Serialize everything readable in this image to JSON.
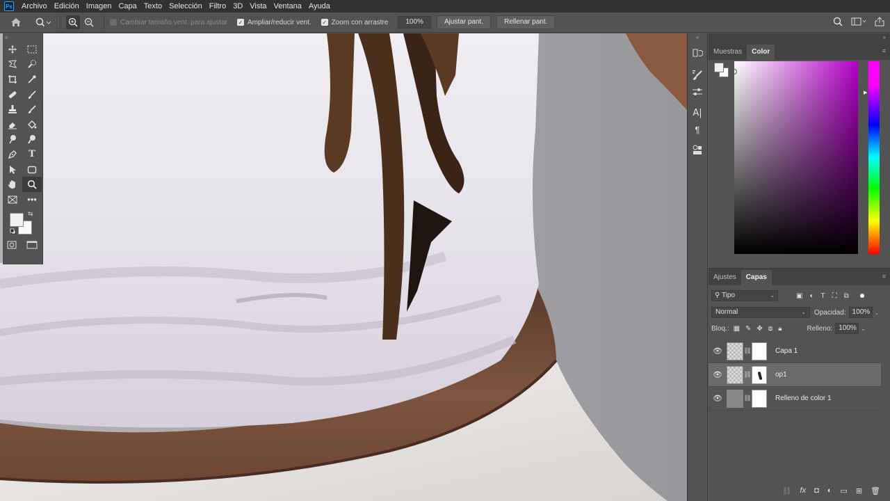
{
  "app": {
    "logo_text": "Ps"
  },
  "menu": [
    "Archivo",
    "Edición",
    "Imagen",
    "Capa",
    "Texto",
    "Selección",
    "Filtro",
    "3D",
    "Vista",
    "Ventana",
    "Ayuda"
  ],
  "options": {
    "resize_windows_label": "Cambiar tamaño vent. para ajustar",
    "zoom_all_label": "Ampliar/reducir vent.",
    "scrubby_zoom_label": "Zoom con arrastre",
    "zoom_value": "100%",
    "fit_screen_label": "Ajustar pant.",
    "fill_screen_label": "Rellenar pant."
  },
  "color_panel": {
    "tabs": [
      "Muestras",
      "Color"
    ],
    "active_tab": "Color",
    "foreground": "#f0f0f0",
    "background": "#ffffff"
  },
  "layers_panel": {
    "tabs": [
      "Ajustes",
      "Capas"
    ],
    "active_tab": "Capas",
    "filter_label": "Tipo",
    "blend_mode": "Normal",
    "opacity_label": "Opacidad:",
    "opacity_value": "100%",
    "lock_label": "Bloq.:",
    "fill_label": "Relleno:",
    "fill_value": "100%",
    "layers": [
      {
        "name": "Capa 1",
        "selected": false
      },
      {
        "name": "op1",
        "selected": true
      },
      {
        "name": "Relleno de color 1",
        "selected": false
      }
    ]
  },
  "icons": {
    "toolbar": [
      "move-icon",
      "marquee-icon",
      "lasso-icon",
      "quick-select-icon",
      "crop-icon",
      "eyedropper-icon",
      "healing-icon",
      "brush-icon",
      "stamp-icon",
      "history-brush-icon",
      "eraser-icon",
      "bucket-icon",
      "smudge-icon",
      "dodge-icon",
      "pen-icon",
      "type-icon",
      "path-select-icon",
      "rectangle-icon",
      "hand-icon",
      "zoom-icon",
      "frame-icon",
      "more-icon"
    ]
  }
}
